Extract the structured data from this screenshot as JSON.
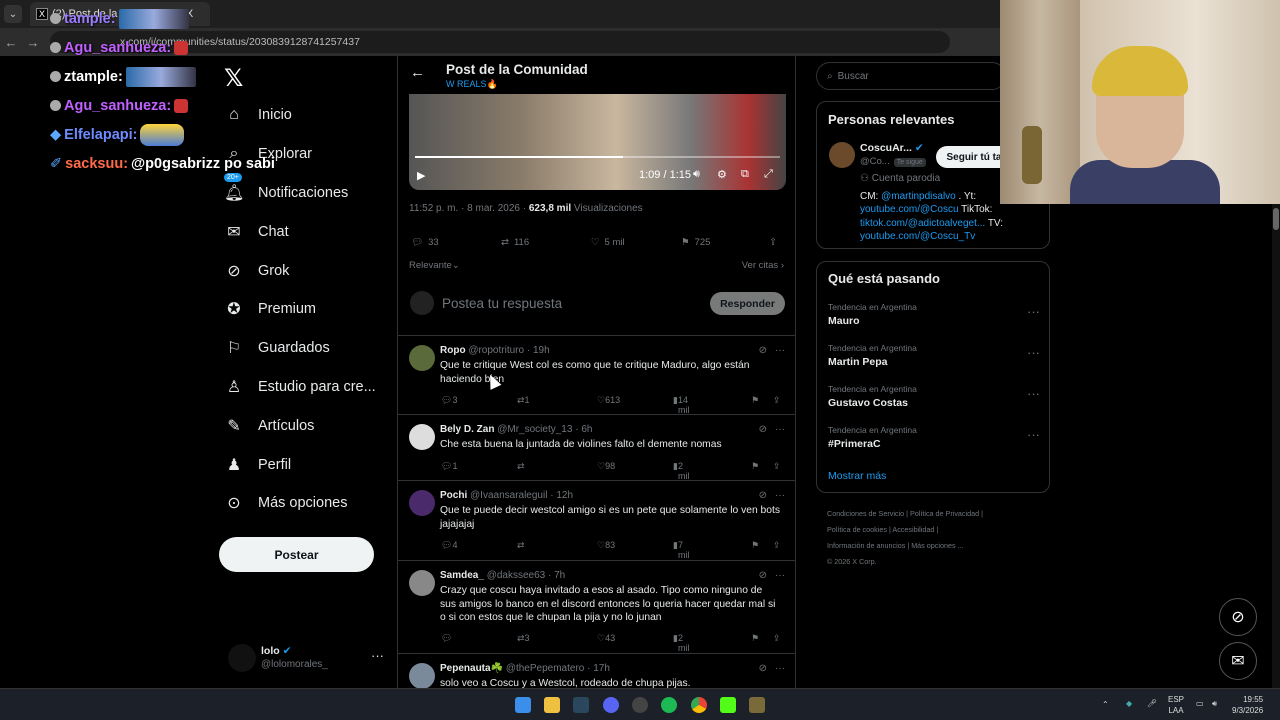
{
  "browser": {
    "tab_title": "(2) Post de la Comunidad / X",
    "url": "x.com/i/communities/status/2030839128741257437"
  },
  "stream_chat": [
    {
      "user": "tample:",
      "text": ""
    },
    {
      "user": "Agu_sanhueza:",
      "text": ""
    },
    {
      "user": "ztample:",
      "text": ""
    },
    {
      "user": "Agu_sanhueza:",
      "text": ""
    },
    {
      "user": "Elfelapapi:",
      "text": ""
    },
    {
      "user": "sacksuu:",
      "text": "@p0gsabrizz po sabi"
    }
  ],
  "nav": {
    "items": [
      {
        "label": "Inicio",
        "icon": "home-icon"
      },
      {
        "label": "Explorar",
        "icon": "search-icon"
      },
      {
        "label": "Notificaciones",
        "icon": "bell-icon",
        "badge": "20+"
      },
      {
        "label": "Chat",
        "icon": "mail-icon"
      },
      {
        "label": "Grok",
        "icon": "grok-icon"
      },
      {
        "label": "Premium",
        "icon": "premium-icon"
      },
      {
        "label": "Guardados",
        "icon": "bookmark-icon"
      },
      {
        "label": "Estudio para cre...",
        "icon": "studio-icon"
      },
      {
        "label": "Artículos",
        "icon": "articles-icon"
      },
      {
        "label": "Perfil",
        "icon": "user-icon"
      },
      {
        "label": "Más opciones",
        "icon": "more-circle-icon"
      }
    ],
    "post_button": "Postear",
    "account": {
      "name": "lolo",
      "handle": "@lolomorales_"
    }
  },
  "post": {
    "header_title": "Post de la Comunidad",
    "community": "W REALS🔥",
    "video_time": "1:09 / 1:15",
    "video_progress": 0.57,
    "timestamp": "11:52 p. m. · 8 mar. 2026 · ",
    "views_count": "623,8 mil",
    "views_label": " Visualizaciones",
    "replies": "33",
    "reposts": "116",
    "likes": "5 mil",
    "bookmarks": "725",
    "sort_label": "Relevante",
    "quotes_link": "Ver citas",
    "reply_placeholder": "Postea tu respuesta",
    "reply_button": "Responder"
  },
  "tweets": [
    {
      "name": "Ropo",
      "handle": "@ropotrituro · 19h",
      "text": "Que te critique West col es como que te critique Maduro, algo están haciendo bien",
      "replies": "3",
      "reposts": "1",
      "likes": "613",
      "views": "14 mil"
    },
    {
      "name": "Bely D. Zan",
      "handle": "@Mr_society_13 · 6h",
      "text": "Che esta buena la juntada de violines falto el demente nomas",
      "replies": "1",
      "reposts": "",
      "likes": "98",
      "views": "2 mil"
    },
    {
      "name": "Pochi",
      "handle": "@Ivaansaraleguil · 12h",
      "text": "Que te puede decir westcol amigo si es un pete que solamente lo ven bots jajajajaj",
      "replies": "4",
      "reposts": "",
      "likes": "83",
      "views": "7 mil"
    },
    {
      "name": "Samdea_",
      "handle": "@dakssee63 · 7h",
      "text": "Crazy que coscu haya invitado a esos al asado. Tipo como ninguno de sus amigos lo banco en el discord entonces lo queria hacer quedar mal si o si con estos que le chupan la pija y no lo junan",
      "replies": "",
      "reposts": "3",
      "likes": "43",
      "views": "2 mil"
    },
    {
      "name": "Pepenauta☘️",
      "handle": "@thePepematero · 17h",
      "text": "solo veo a Coscu y a Westcol, rodeado de chupa pijas.",
      "replies": "",
      "reposts": "",
      "likes": "",
      "views": ""
    }
  ],
  "sidebar": {
    "search_placeholder": "Buscar",
    "relevant_title": "Personas relevantes",
    "relevant_name": "CoscuAr...",
    "relevant_handle": "@Co...",
    "relevant_tag": "Te sigue",
    "follow_button": "Seguir tú ta",
    "parody": "Cuenta parodia",
    "bio_1": "CM: ",
    "bio_1_link": "@martinpdisalvo",
    "bio_2": " . Yt:",
    "bio_3_link": "youtube.com/@Coscu",
    "bio_4": " TikTok:",
    "bio_5_link": "tiktok.com/@adictoalveget...",
    "bio_6": " TV:",
    "bio_7_link": "youtube.com/@Coscu_Tv",
    "trending_title": "Qué está pasando",
    "trends": [
      {
        "context": "Tendencia en Argentina",
        "topic": "Mauro"
      },
      {
        "context": "Tendencia en Argentina",
        "topic": "Martin Pepa"
      },
      {
        "context": "Tendencia en Argentina",
        "topic": "Gustavo Costas"
      },
      {
        "context": "Tendencia en Argentina",
        "topic": "#PrimeraC"
      }
    ],
    "show_more": "Mostrar más",
    "footer": [
      "Condiciones de Servicio",
      "|",
      "Política de Privacidad",
      "|",
      "Política de cookies",
      "|",
      "Accesibilidad",
      "|",
      "Información de anuncios",
      "|",
      "Más opciones ...",
      "© 2026 X Corp."
    ]
  },
  "taskbar": {
    "lang_1": "ESP",
    "lang_2": "LAA",
    "time": "19:55",
    "date": "9/3/2026"
  },
  "colors": {
    "accent": "#1d9bf0",
    "bg": "#000000",
    "border": "#2f3336"
  }
}
